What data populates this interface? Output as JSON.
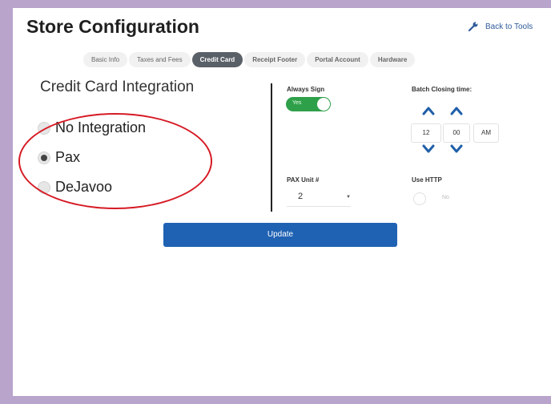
{
  "page": {
    "title": "Store Configuration",
    "back_link": "Back to Tools"
  },
  "tabs": [
    {
      "label": "Basic Info",
      "active": false
    },
    {
      "label": "Taxes and Fees",
      "active": false
    },
    {
      "label": "Credit Card",
      "active": true
    },
    {
      "label": "Receipt Footer",
      "active": false
    },
    {
      "label": "Portal Account",
      "active": false
    },
    {
      "label": "Hardware",
      "active": false
    }
  ],
  "credit_card": {
    "heading": "Credit Card Integration",
    "options": [
      {
        "label": "No Integration",
        "selected": false
      },
      {
        "label": "Pax",
        "selected": true
      },
      {
        "label": "DeJavoo",
        "selected": false
      }
    ]
  },
  "settings": {
    "always_sign_label": "Always Sign",
    "always_sign_state": "Yes",
    "batch_label": "Batch Closing time:",
    "batch_hour": "12",
    "batch_minute": "00",
    "batch_ampm": "AM",
    "pax_unit_label": "PAX Unit #",
    "pax_unit_value": "2",
    "use_http_label": "Use HTTP",
    "use_http_state": "No"
  },
  "actions": {
    "update_label": "Update"
  },
  "colors": {
    "accent": "#1f62b3",
    "toggle_on": "#2fa04a",
    "annotation": "#d61a24",
    "background": "#b9a4cc"
  }
}
